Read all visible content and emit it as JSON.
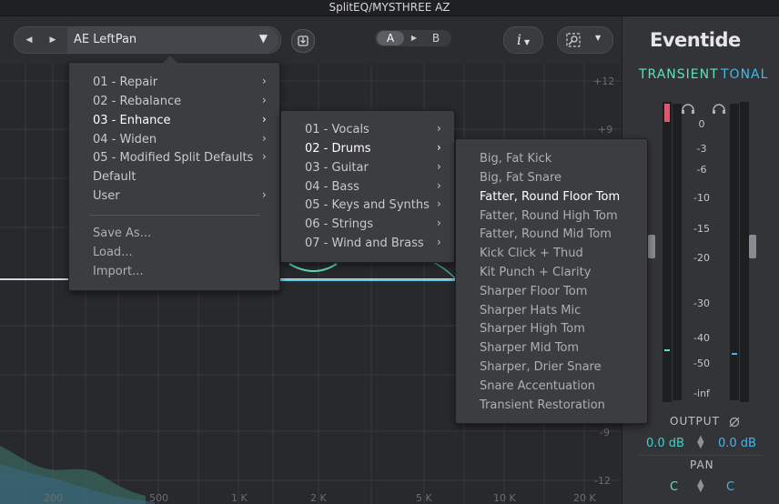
{
  "window": {
    "title": "SplitEQ/MYSTHREE AZ"
  },
  "toolbar": {
    "preset_name": "AE LeftPan",
    "ab": {
      "a": "A",
      "b": "B"
    },
    "info_label": "i"
  },
  "menu_level1": {
    "items": [
      "01 - Repair",
      "02 - Rebalance",
      "03 - Enhance",
      "04 - Widen",
      "05 - Modified Split Defaults",
      "Default",
      "User"
    ],
    "actions": [
      "Save As...",
      "Load...",
      "Import..."
    ]
  },
  "menu_level2": {
    "items": [
      "01 - Vocals",
      "02 - Drums",
      "03 - Guitar",
      "04 - Bass",
      "05 - Keys and Synths",
      "06 - Strings",
      "07 - Wind and Brass"
    ]
  },
  "menu_level3": {
    "items": [
      "Big, Fat Kick",
      "Big, Fat Snare",
      "Fatter, Round Floor Tom",
      "Fatter, Round High Tom",
      "Fatter, Round Mid Tom",
      "Kick Click + Thud",
      "Kit Punch + Clarity",
      "Sharper Floor Tom",
      "Sharper Hats Mic",
      "Sharper High Tom",
      "Sharper Mid Tom",
      "Sharper, Drier Snare",
      "Snare Accentuation",
      "Transient Restoration"
    ]
  },
  "graph": {
    "freq_labels": [
      "200",
      "500",
      "1 K",
      "2 K",
      "5 K",
      "10 K",
      "20 K"
    ],
    "db_labels": [
      "+12",
      "+9",
      "-9",
      "-12"
    ]
  },
  "right_panel": {
    "brand": "Eventide",
    "mode_transient": "TRANSIENT",
    "mode_tonal": "TONAL",
    "scale": [
      "0",
      "-3",
      "-6",
      "-10",
      "-15",
      "-20",
      "-30",
      "-40",
      "-50",
      "-inf"
    ],
    "output_label": "OUTPUT",
    "output_left": "0.0 dB",
    "output_right": "0.0 dB",
    "pan_label": "PAN",
    "pan_left": "C",
    "pan_right": "C"
  },
  "colors": {
    "transient": "#5fe0b8",
    "tonal": "#43b8e8",
    "background": "#28292c"
  }
}
